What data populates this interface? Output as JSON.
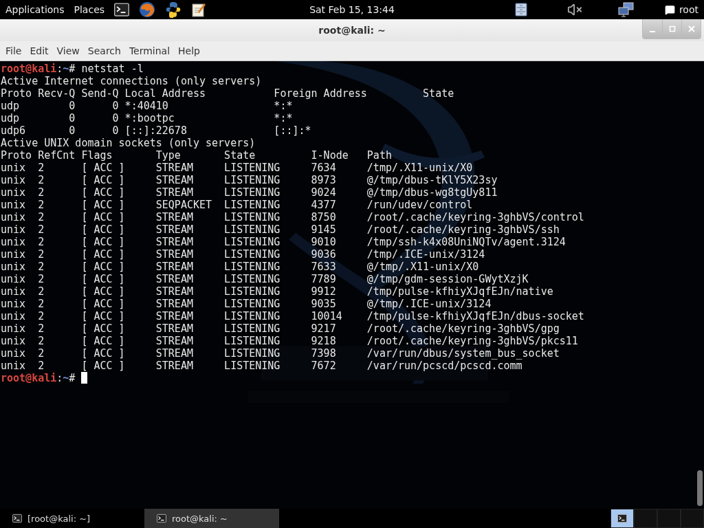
{
  "top_panel": {
    "menus": [
      "Applications",
      "Places"
    ],
    "clock": "Sat Feb 15, 13:44",
    "user": "root"
  },
  "window": {
    "title": "root@kali: ~"
  },
  "menu_bar": [
    "File",
    "Edit",
    "View",
    "Search",
    "Terminal",
    "Help"
  ],
  "terminal": {
    "lines": [
      {
        "kind": "prompt",
        "user": "root@kali",
        "sep": ":",
        "cwd": "~",
        "mark": "#",
        "command": "netstat -l"
      },
      {
        "kind": "output",
        "text": "Active Internet connections (only servers)"
      },
      {
        "kind": "output",
        "text": "Proto Recv-Q Send-Q Local Address           Foreign Address         State"
      },
      {
        "kind": "output",
        "text": "udp        0      0 *:40410                 *:*"
      },
      {
        "kind": "output",
        "text": "udp        0      0 *:bootpc                *:*"
      },
      {
        "kind": "output",
        "text": "udp6       0      0 [::]:22678              [::]:*"
      },
      {
        "kind": "output",
        "text": "Active UNIX domain sockets (only servers)"
      },
      {
        "kind": "output",
        "text": "Proto RefCnt Flags       Type       State         I-Node   Path"
      },
      {
        "kind": "output",
        "text": "unix  2      [ ACC ]     STREAM     LISTENING     7634     /tmp/.X11-unix/X0"
      },
      {
        "kind": "output",
        "text": "unix  2      [ ACC ]     STREAM     LISTENING     8973     @/tmp/dbus-tKlY5X23sy"
      },
      {
        "kind": "output",
        "text": "unix  2      [ ACC ]     STREAM     LISTENING     9024     @/tmp/dbus-wg8tgUy811"
      },
      {
        "kind": "output",
        "text": "unix  2      [ ACC ]     SEQPACKET  LISTENING     4377     /run/udev/control"
      },
      {
        "kind": "output",
        "text": "unix  2      [ ACC ]     STREAM     LISTENING     8750     /root/.cache/keyring-3ghbVS/control"
      },
      {
        "kind": "output",
        "text": "unix  2      [ ACC ]     STREAM     LISTENING     9145     /root/.cache/keyring-3ghbVS/ssh"
      },
      {
        "kind": "output",
        "text": "unix  2      [ ACC ]     STREAM     LISTENING     9010     /tmp/ssh-k4x08UniNQTv/agent.3124"
      },
      {
        "kind": "output",
        "text": "unix  2      [ ACC ]     STREAM     LISTENING     9036     /tmp/.ICE-unix/3124"
      },
      {
        "kind": "output",
        "text": "unix  2      [ ACC ]     STREAM     LISTENING     7633     @/tmp/.X11-unix/X0"
      },
      {
        "kind": "output",
        "text": "unix  2      [ ACC ]     STREAM     LISTENING     7789     @/tmp/gdm-session-GWytXzjK"
      },
      {
        "kind": "output",
        "text": "unix  2      [ ACC ]     STREAM     LISTENING     9912     /tmp/pulse-kfhiyXJqfEJn/native"
      },
      {
        "kind": "output",
        "text": "unix  2      [ ACC ]     STREAM     LISTENING     9035     @/tmp/.ICE-unix/3124"
      },
      {
        "kind": "output",
        "text": "unix  2      [ ACC ]     STREAM     LISTENING     10014    /tmp/pulse-kfhiyXJqfEJn/dbus-socket"
      },
      {
        "kind": "output",
        "text": "unix  2      [ ACC ]     STREAM     LISTENING     9217     /root/.cache/keyring-3ghbVS/gpg"
      },
      {
        "kind": "output",
        "text": "unix  2      [ ACC ]     STREAM     LISTENING     9218     /root/.cache/keyring-3ghbVS/pkcs11"
      },
      {
        "kind": "output",
        "text": "unix  2      [ ACC ]     STREAM     LISTENING     7398     /var/run/dbus/system_bus_socket"
      },
      {
        "kind": "output",
        "text": "unix  2      [ ACC ]     STREAM     LISTENING     7672     /var/run/pcscd/pcscd.comm"
      },
      {
        "kind": "prompt",
        "user": "root@kali",
        "sep": ":",
        "cwd": "~",
        "mark": "#",
        "cursor": true
      }
    ]
  },
  "taskbar": {
    "tasks": [
      {
        "label": "[root@kali: ~]",
        "selected": false
      },
      {
        "label": "root@kali: ~",
        "selected": true
      }
    ],
    "workspaces": [
      {
        "selected": true
      },
      {
        "selected": false
      },
      {
        "selected": false
      },
      {
        "selected": false
      }
    ]
  }
}
